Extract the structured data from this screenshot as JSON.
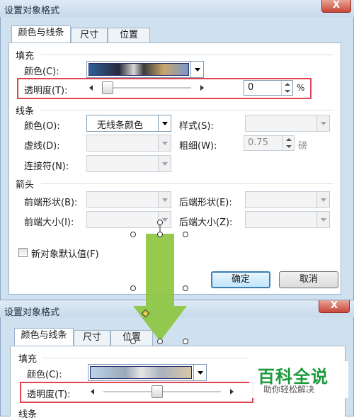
{
  "dialog": {
    "title": "设置对象格式",
    "close_label": "X",
    "tabs": [
      "颜色与线条",
      "尺寸",
      "位置"
    ]
  },
  "fill": {
    "section": "填充",
    "color_label": "颜色(C):",
    "transparency_label": "透明度(T):",
    "transparency_value": "0",
    "transparency_unit": "%",
    "transparency_fraction": 0.0
  },
  "line": {
    "section": "线条",
    "color_label": "颜色(O):",
    "color_value": "无线条颜色",
    "style_label": "样式(S):",
    "dash_label": "虚线(D):",
    "weight_label": "粗细(W):",
    "weight_value": "0.75",
    "weight_unit": "磅",
    "connector_label": "连接符(N):"
  },
  "arrows": {
    "section": "箭头",
    "begin_style_label": "前端形状(B):",
    "end_style_label": "后端形状(E):",
    "begin_size_label": "前端大小(I):",
    "end_size_label": "后端大小(Z):"
  },
  "default_checkbox_label": "新对象默认值(F)",
  "ok_label": "确定",
  "cancel_label": "取消",
  "dialog2": {
    "title": "设置对象格式",
    "close_label": "X",
    "tabs": [
      "颜色与线条",
      "尺寸",
      "位置"
    ],
    "fill_section": "填充",
    "color_label": "颜色(C):",
    "transparency_label": "透明度(T):",
    "line_section": "线条",
    "transparency_fraction": 0.45
  },
  "watermark": {
    "main": "百科全说",
    "sub": "助你轻松解决"
  },
  "colors": {
    "dialog_bg": "#cfe0ef",
    "highlight_red": "#e0434f",
    "arrow_green": "#8cc63f",
    "watermark_green": "#1a9a3a"
  }
}
